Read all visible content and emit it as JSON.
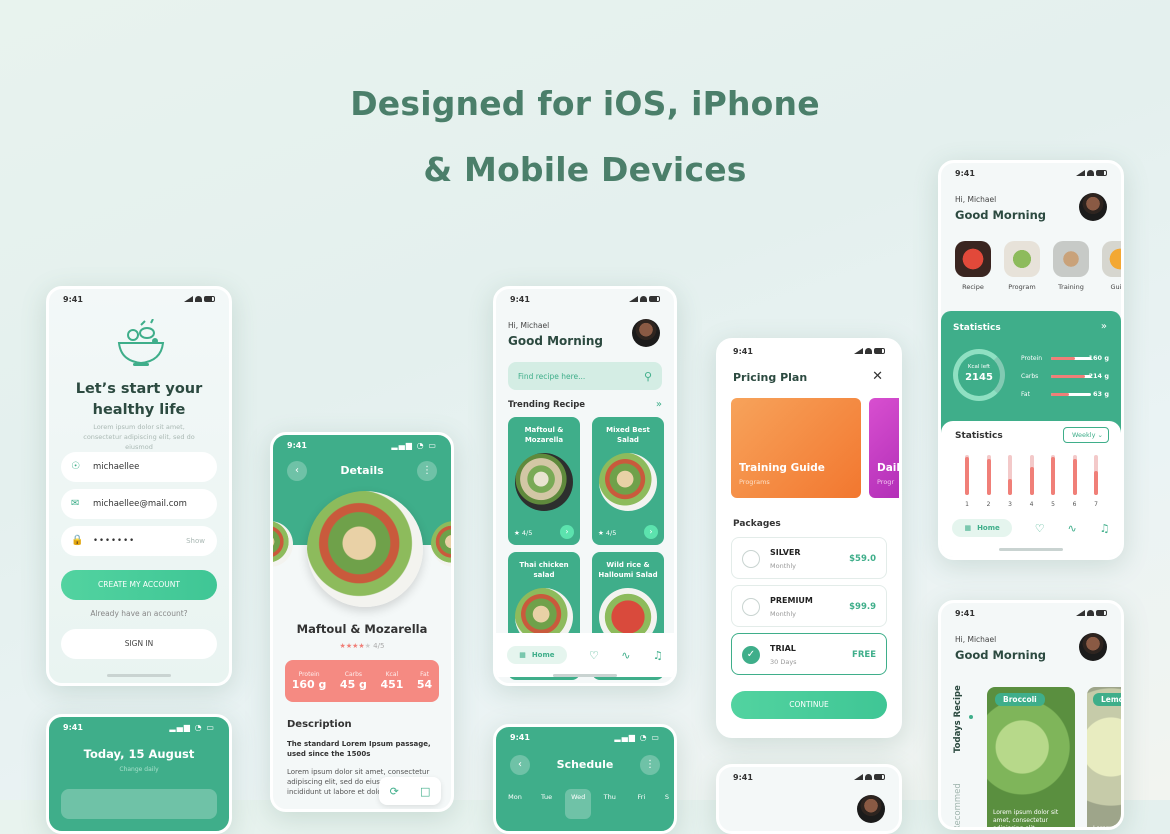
{
  "headline": {
    "line1": "Designed for iOS, iPhone",
    "line2": "& Mobile Devices"
  },
  "status_time": "9:41",
  "colors": {
    "primary": "#3fae8a",
    "accent": "#52d3a0",
    "text": "#4b7f6a",
    "coral": "#f07f78",
    "orange": "#f58a3c"
  },
  "signup": {
    "title_line1": "Let’s start your",
    "title_line2": "healthy life",
    "subtitle": "Lorem ipsum dolor sit amet, consectetur adipiscing elit, sed do eiusmod",
    "username": "michaellee",
    "email": "michaellee@mail.com",
    "password": "•••••••",
    "show_label": "Show",
    "create_button": "CREATE MY ACCOUNT",
    "have_account": "Already have an account?",
    "signin_button": "SIGN IN"
  },
  "details": {
    "header": "Details",
    "dish": "Maftoul & Mozarella",
    "rating": "4/5",
    "stars": 4,
    "macros": [
      {
        "label": "Protein",
        "value": "160 g"
      },
      {
        "label": "Carbs",
        "value": "45 g"
      },
      {
        "label": "Kcal",
        "value": "451"
      },
      {
        "label": "Fat",
        "value": "54"
      }
    ],
    "desc_title": "Description",
    "desc_bold": "The standard Lorem Ipsum passage, used since the 1500s",
    "desc_text": "Lorem ipsum dolor sit amet, consectetur adipiscing elit, sed do eiusmod tempor incididunt ut labore et dolore magna aliqua"
  },
  "home": {
    "greeting": "Hi, Michael",
    "title": "Good Morning",
    "search_placeholder": "Find recipe here...",
    "trending": "Trending Recipe",
    "recipes": [
      {
        "name": "Maftoul & Mozarella",
        "rate": "4/5"
      },
      {
        "name": "Mixed Best Salad",
        "rate": "4/5"
      },
      {
        "name": "Thai chicken salad",
        "rate": ""
      },
      {
        "name": "Wild rice & Halloumi Salad",
        "rate": ""
      }
    ],
    "nav_home": "Home"
  },
  "pricing": {
    "title": "Pricing Plan",
    "card1_title": "Training Guide",
    "card1_sub": "Programs",
    "card2_title": "Dail",
    "card2_sub": "Progr",
    "packages_label": "Packages",
    "packages": [
      {
        "name": "SILVER",
        "period": "Monthly",
        "price": "$59.0"
      },
      {
        "name": "PREMIUM",
        "period": "Monthly",
        "price": "$99.9"
      },
      {
        "name": "TRIAL",
        "period": "30 Days",
        "price": "FREE"
      }
    ],
    "continue": "CONTINUE"
  },
  "dashboard": {
    "greeting": "Hi, Michael",
    "title": "Good Morning",
    "categories": [
      "Recipe",
      "Program",
      "Training",
      "Guide"
    ],
    "stats_title": "Statistics",
    "kcal_label": "Kcal left",
    "kcal_value": "2145",
    "nutrients": [
      {
        "name": "Protein",
        "value": "160 g",
        "fill": 0.6
      },
      {
        "name": "Carbs",
        "value": "214 g",
        "fill": 0.85
      },
      {
        "name": "Fat",
        "value": "63 g",
        "fill": 0.45
      }
    ],
    "stats2_title": "Statistics",
    "period": "Weekly",
    "week_days": [
      "1",
      "2",
      "3",
      "4",
      "5",
      "6",
      "7"
    ],
    "week_values": [
      0.95,
      0.9,
      0.4,
      0.7,
      0.95,
      0.9,
      0.6
    ],
    "nav_home": "Home"
  },
  "schedule": {
    "date": "Today, 15 August",
    "sub": "Change daily",
    "title": "Schedule",
    "days": [
      "Mon",
      "Tue",
      "Wed",
      "Thu",
      "Fri",
      "S"
    ]
  },
  "recommend": {
    "greeting": "Hi, Michael",
    "title": "Good Morning",
    "vertical1": "Todays Recipe",
    "vertical2": "Recommed",
    "card1": "Broccoli",
    "card2": "Lemo",
    "card_text": "Lorem ipsum dolor sit amet, consectetur adipiscing elit,"
  }
}
